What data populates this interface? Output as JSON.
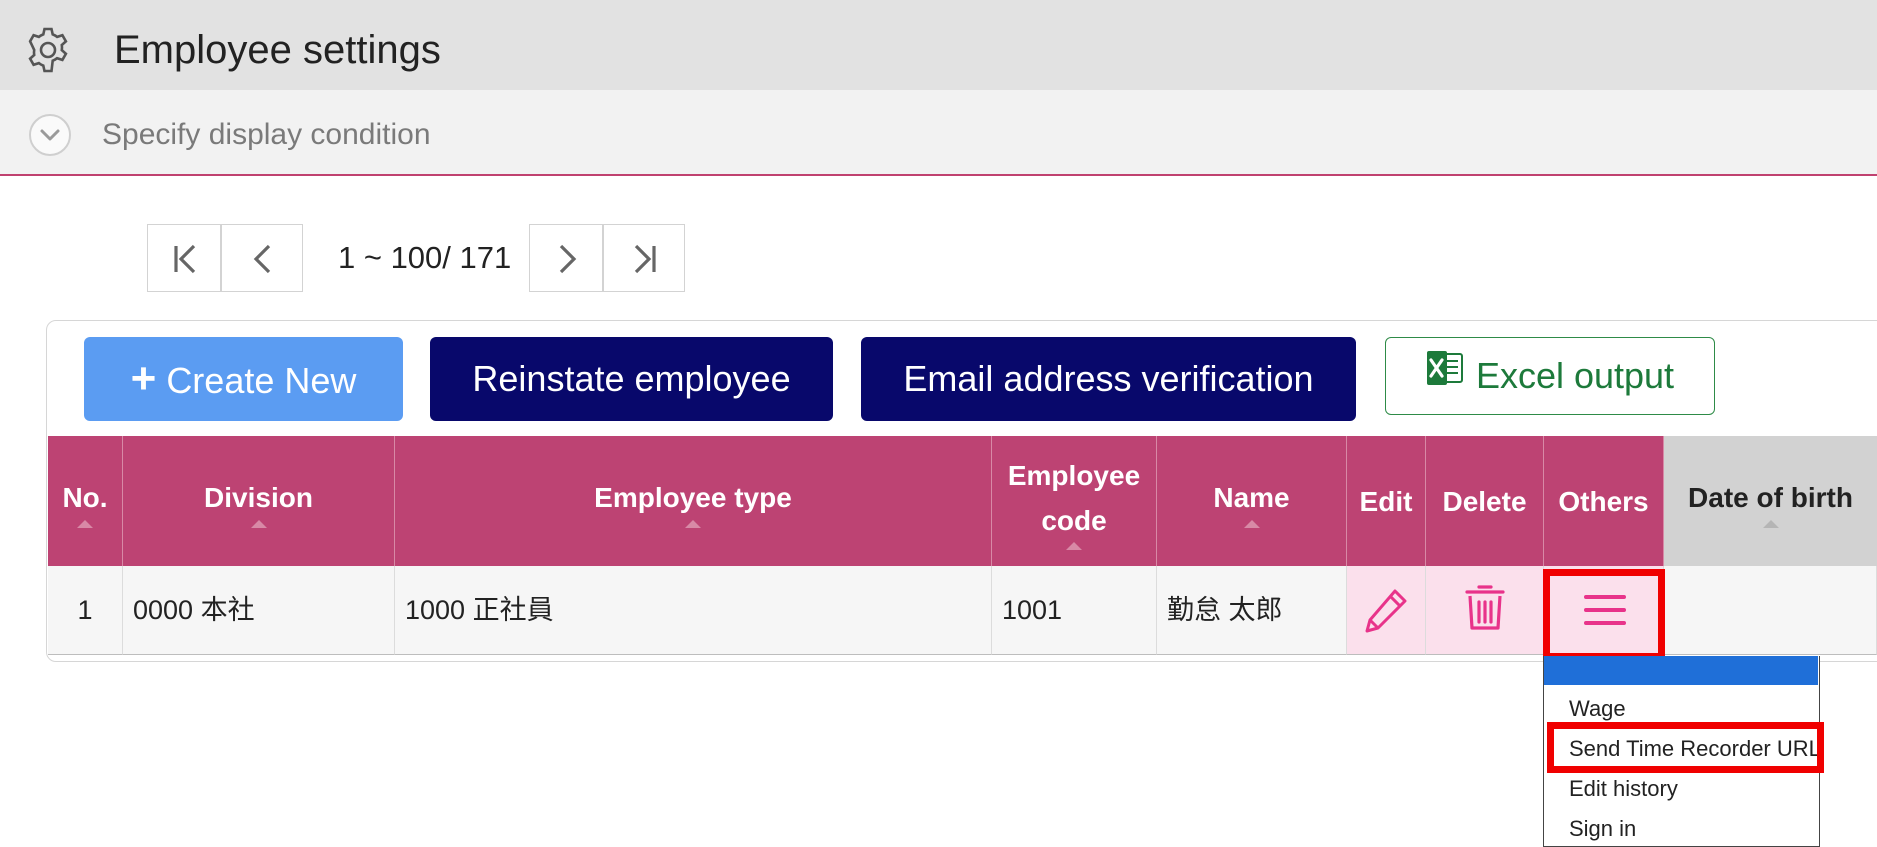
{
  "header": {
    "title": "Employee settings",
    "icon": "gear-icon"
  },
  "condition": {
    "label": "Specify display condition",
    "icon": "chevron-down-icon"
  },
  "pager": {
    "range_text": "1 ~ 100/ 171"
  },
  "toolbar": {
    "create_label": "Create New",
    "reinstate_label": "Reinstate employee",
    "verify_label": "Email address verification",
    "excel_label": "Excel output"
  },
  "table": {
    "headers": {
      "no": "No.",
      "division": "Division",
      "employee_type": "Employee type",
      "employee_code_1": "Employee",
      "employee_code_2": "code",
      "name": "Name",
      "edit": "Edit",
      "delete": "Delete",
      "others": "Others",
      "birth": "Date of birth"
    },
    "rows": [
      {
        "no": "1",
        "division": "0000 本社",
        "employee_type": "1000 正社員",
        "code": "1001",
        "name": "勤怠 太郎"
      }
    ]
  },
  "menu": {
    "items": [
      "Wage",
      "Send Time Recorder URL",
      "Edit history",
      "Sign in"
    ]
  },
  "colors": {
    "header_bg": "#e2e2e2",
    "table_header": "#bd4373",
    "create_button": "#5b9cf2",
    "navy_button": "#08086b",
    "excel_green": "#1d7a3b",
    "highlight_red": "#f00000",
    "menu_highlight": "#1f6fd8"
  }
}
